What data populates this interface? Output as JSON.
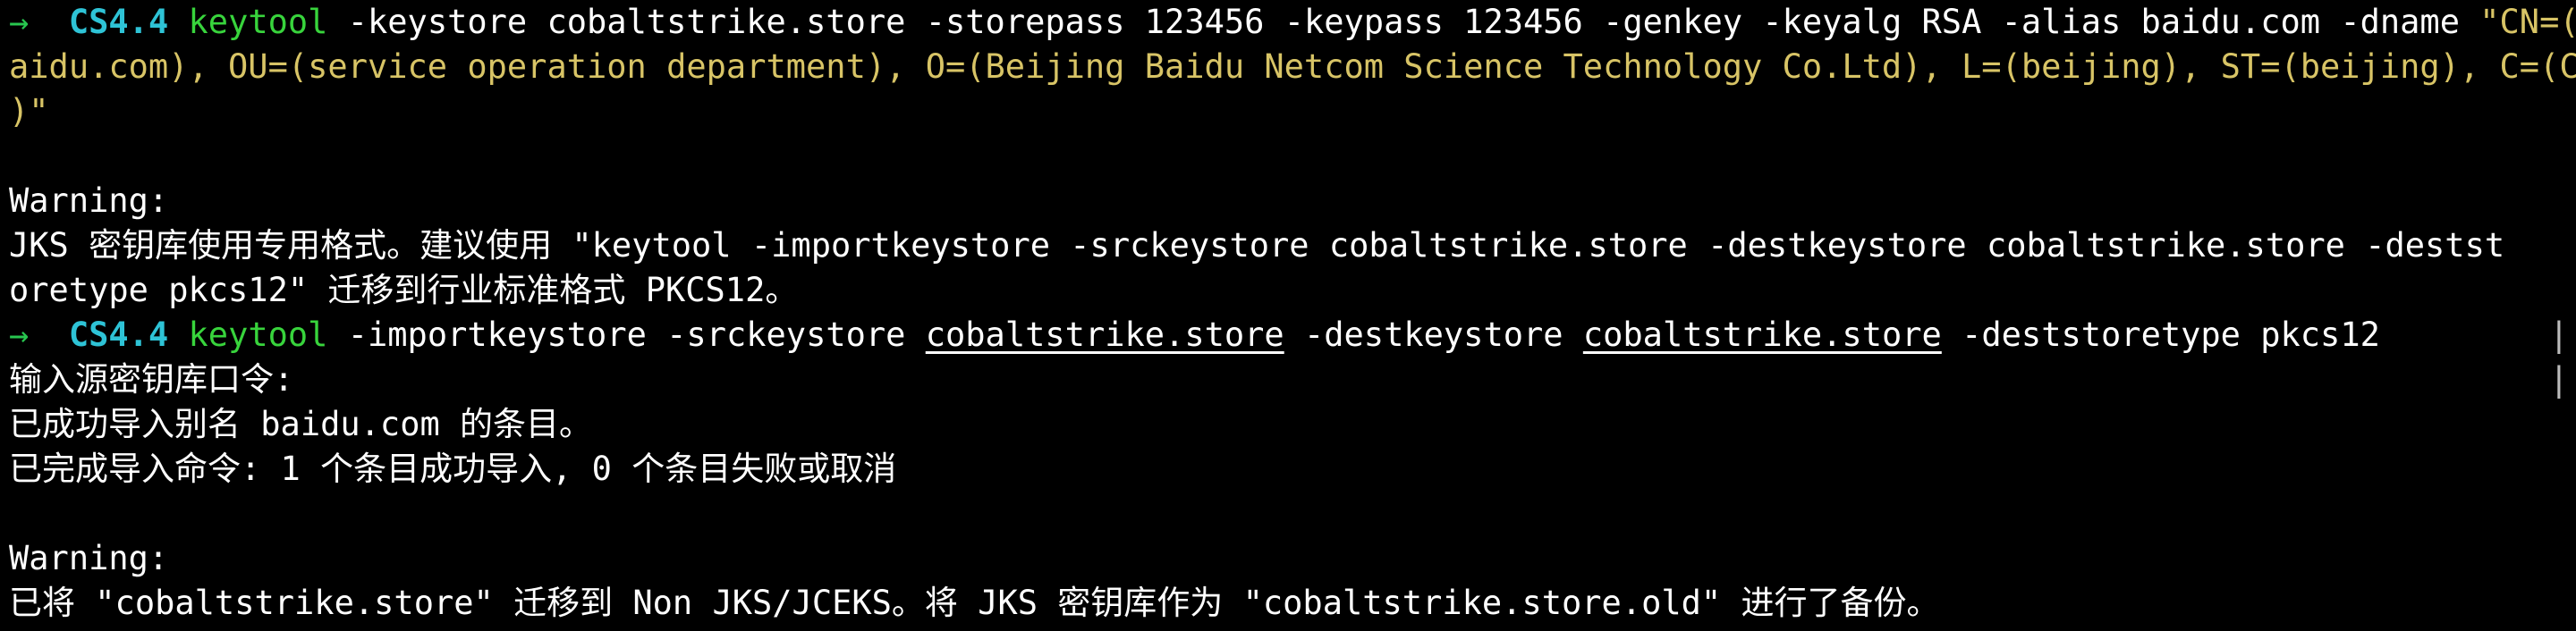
{
  "prompt": {
    "arrow": "→",
    "project": "CS4.4"
  },
  "commands": {
    "first": {
      "name": "keytool",
      "args": " -keystore cobaltstrike.store -storepass 123456 -keypass 123456 -genkey -keyalg RSA -alias baidu.com -dname ",
      "dname_part1": "\"CN=(b",
      "dname_part2": "aidu.com), OU=(service operation department), O=(Beijing Baidu Netcom Science Technology Co.Ltd), L=(beijing), ST=(beijing), C=(CN",
      "dname_part3": ")\""
    },
    "second": {
      "name": "keytool",
      "opt1": " -importkeystore -srckeystore ",
      "src": "cobaltstrike.store",
      "opt2": " -destkeystore ",
      "dest": "cobaltstrike.store",
      "opt3": " -deststoretype pkcs12"
    }
  },
  "output": {
    "warning1_label": "Warning:",
    "warning1_line1": "JKS 密钥库使用专用格式。建议使用 \"keytool -importkeystore -srckeystore cobaltstrike.store -destkeystore cobaltstrike.store -destst",
    "warning1_line2": "oretype pkcs12\" 迁移到行业标准格式 PKCS12。",
    "prompt_source": "输入源密钥库口令:",
    "import_success": "已成功导入别名 baidu.com 的条目。",
    "import_done": "已完成导入命令: 1 个条目成功导入, 0 个条目失败或取消",
    "warning2_label": "Warning:",
    "warning2_line": "已将 \"cobaltstrike.store\" 迁移到 Non JKS/JCEKS。将 JKS 密钥库作为 \"cobaltstrike.store.old\" 进行了备份。"
  },
  "colors": {
    "background": "#000000",
    "prompt_arrow": "#28c64f",
    "project": "#2ec3d6",
    "command": "#38d43c",
    "string": "#d8c466",
    "text": "#ffffff"
  }
}
